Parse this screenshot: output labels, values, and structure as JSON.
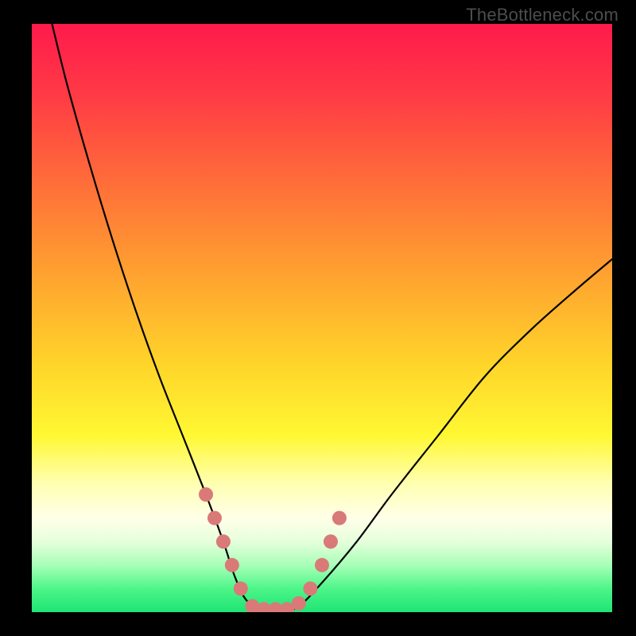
{
  "watermark": "TheBottleneck.com",
  "chart_data": {
    "type": "line",
    "title": "",
    "xlabel": "",
    "ylabel": "",
    "xlim": [
      0,
      100
    ],
    "ylim": [
      0,
      100
    ],
    "gradient_stops": [
      {
        "pos": 0,
        "color": "#ff1a4b"
      },
      {
        "pos": 12,
        "color": "#ff3a45"
      },
      {
        "pos": 26,
        "color": "#ff6a3a"
      },
      {
        "pos": 42,
        "color": "#ffa030"
      },
      {
        "pos": 58,
        "color": "#ffd52a"
      },
      {
        "pos": 70,
        "color": "#fff833"
      },
      {
        "pos": 78,
        "color": "#ffffb0"
      },
      {
        "pos": 84,
        "color": "#ffffe8"
      },
      {
        "pos": 88,
        "color": "#e6ffdc"
      },
      {
        "pos": 92,
        "color": "#a8ffb8"
      },
      {
        "pos": 96,
        "color": "#4ef589"
      },
      {
        "pos": 100,
        "color": "#1de574"
      }
    ],
    "series": [
      {
        "name": "bottleneck-curve",
        "x": [
          3,
          6,
          10,
          14,
          18,
          22,
          26,
          30,
          33,
          35,
          37,
          40,
          43,
          46,
          50,
          56,
          62,
          70,
          78,
          86,
          94,
          100
        ],
        "y": [
          102,
          90,
          76,
          63,
          51,
          40,
          30,
          20,
          12,
          6,
          2,
          0,
          0,
          1,
          5,
          12,
          20,
          30,
          40,
          48,
          55,
          60
        ]
      }
    ],
    "markers": {
      "name": "highlight-dots",
      "color": "#d97a78",
      "points": [
        {
          "x": 30,
          "y": 20
        },
        {
          "x": 31.5,
          "y": 16
        },
        {
          "x": 33,
          "y": 12
        },
        {
          "x": 34.5,
          "y": 8
        },
        {
          "x": 36,
          "y": 4
        },
        {
          "x": 38,
          "y": 1
        },
        {
          "x": 40,
          "y": 0.5
        },
        {
          "x": 42,
          "y": 0.5
        },
        {
          "x": 44,
          "y": 0.5
        },
        {
          "x": 46,
          "y": 1.5
        },
        {
          "x": 48,
          "y": 4
        },
        {
          "x": 50,
          "y": 8
        },
        {
          "x": 51.5,
          "y": 12
        },
        {
          "x": 53,
          "y": 16
        }
      ]
    }
  }
}
